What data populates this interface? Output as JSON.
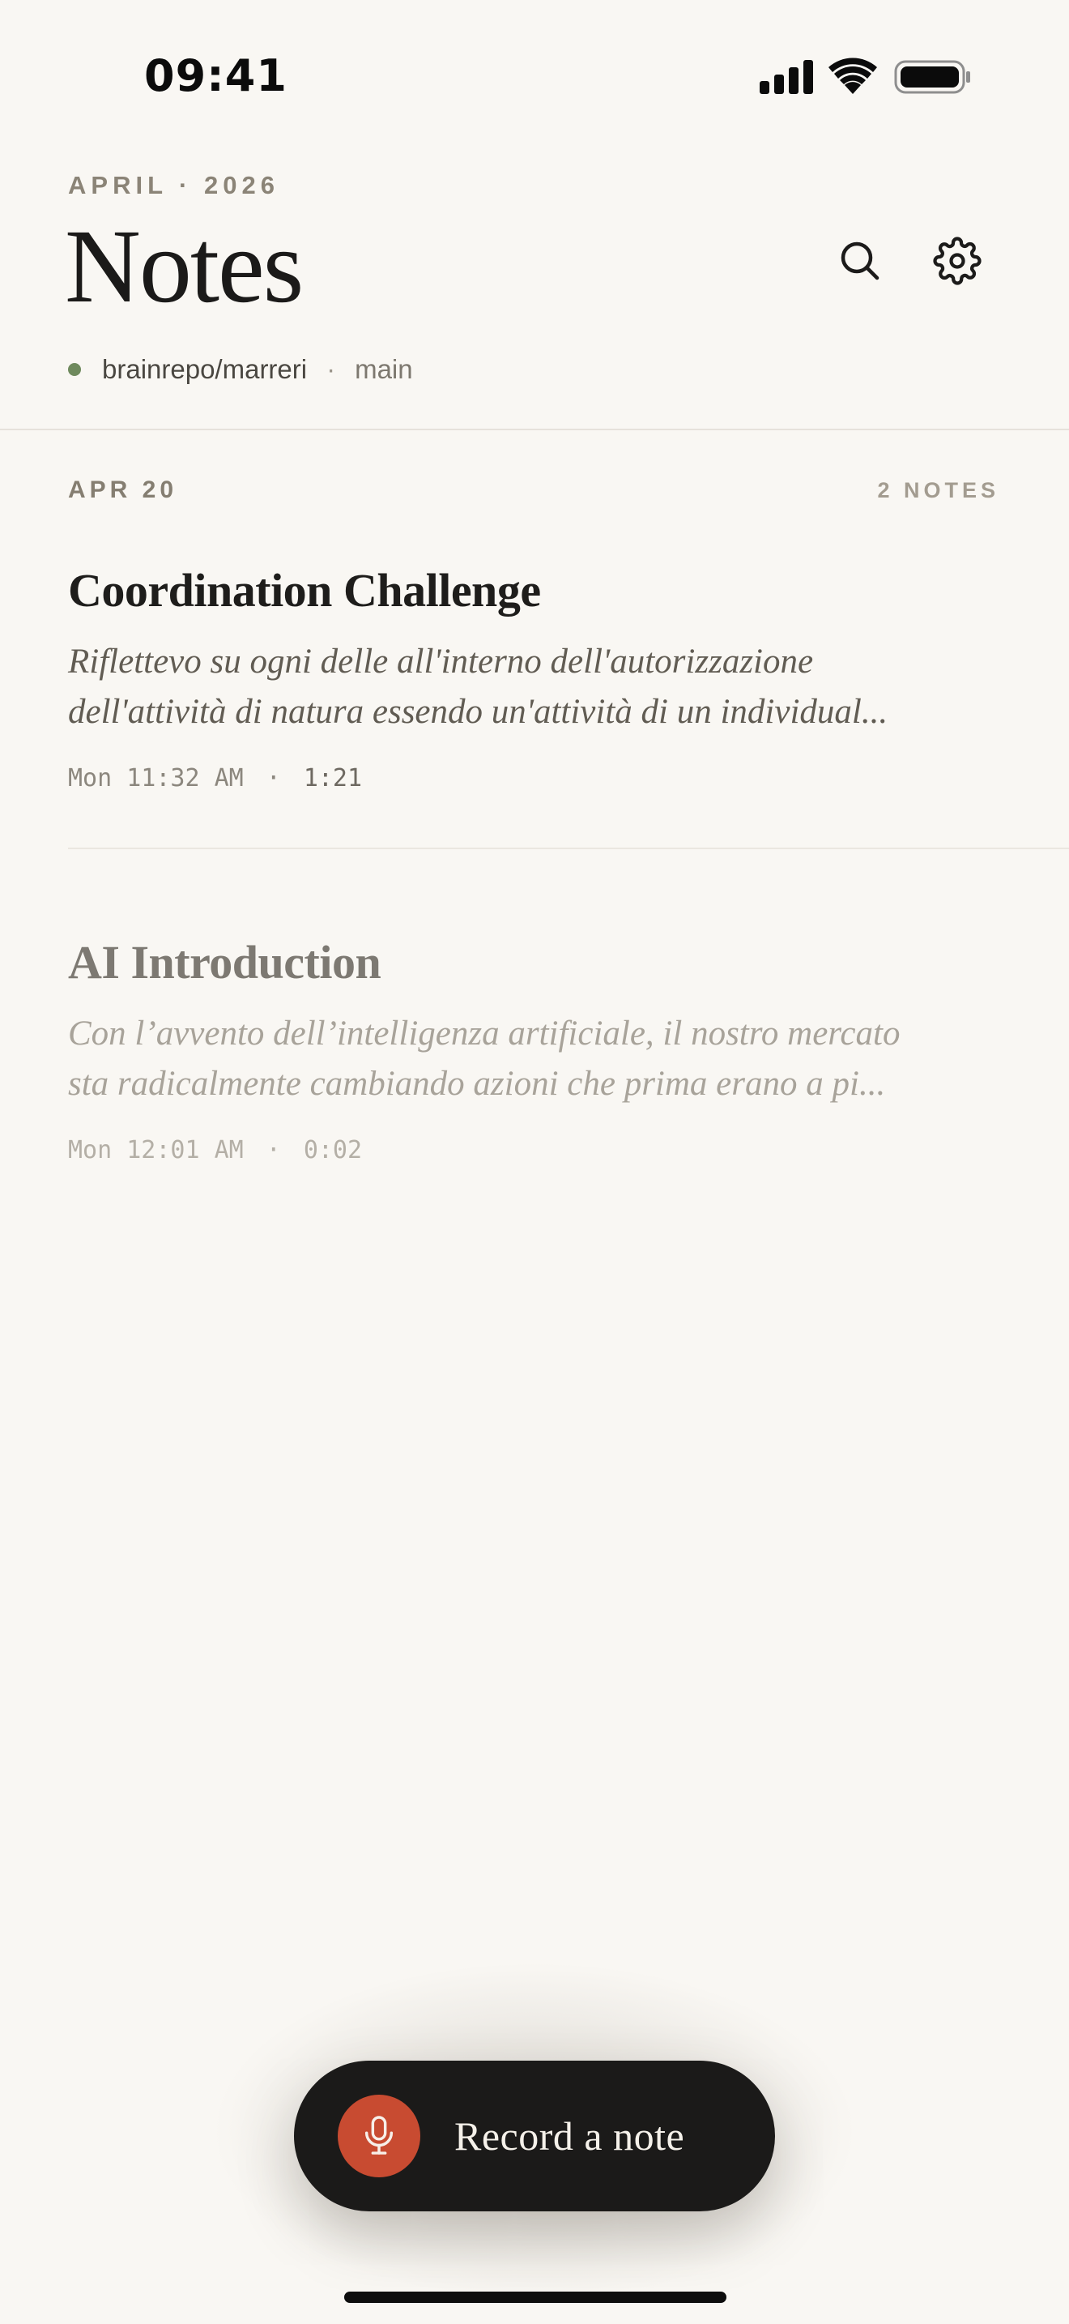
{
  "status_bar": {
    "time": "09:41"
  },
  "header": {
    "eyebrow": "APRIL · 2026",
    "title": "Notes",
    "repo": "brainrepo/marreri",
    "separator": "·",
    "branch": "main"
  },
  "section": {
    "date": "APR 20",
    "count": "2 NOTES"
  },
  "notes": [
    {
      "title": "Coordination Challenge",
      "preview_line1": "Riflettevo su ogni delle all'interno dell'autorizzazione",
      "preview_line2": "dell'attività di natura essendo un'attività di un individual...",
      "time": "Mon 11:32 AM",
      "separator": "·",
      "duration": "1:21"
    },
    {
      "title": "AI Introduction",
      "preview_line1": "Con l’avvento dell’intelligenza artificiale, il nostro mercato",
      "preview_line2": "sta radicalmente cambiando azioni che prima erano a pi...",
      "time": "Mon 12:01 AM",
      "separator": "·",
      "duration": "0:02"
    }
  ],
  "record_button": {
    "label": "Record a note"
  },
  "colors": {
    "background": "#f9f7f3",
    "status_dot": "#6f8a5d",
    "record_button": "#1b1a19",
    "mic_accent": "#c84b31"
  },
  "icons": {
    "search": "search-icon",
    "settings": "gear-icon",
    "mic": "microphone-icon",
    "signal": "cellular-signal-icon",
    "wifi": "wifi-icon",
    "battery": "battery-icon"
  }
}
